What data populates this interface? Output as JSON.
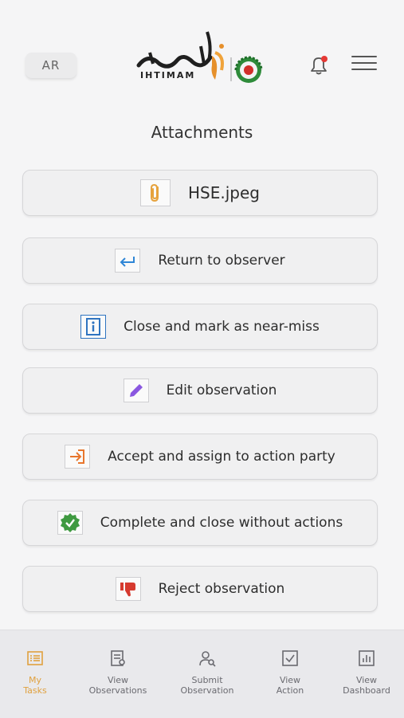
{
  "header": {
    "lang_label": "AR",
    "logo_text": "IHTIMAM",
    "notification_dot_color": "#e53935"
  },
  "page": {
    "title": "Attachments"
  },
  "attachment": {
    "file_name": "HSE.jpeg",
    "icon": "paperclip-icon",
    "icon_color": "#e6a23c"
  },
  "actions": [
    {
      "label": "Return to observer",
      "icon": "return-arrow-icon",
      "icon_color": "#2f86d6"
    },
    {
      "label": "Close and mark as near-miss",
      "icon": "info-icon",
      "icon_color": "#2f74c0"
    },
    {
      "label": "Edit observation",
      "icon": "pencil-icon",
      "icon_color": "#8a57e0"
    },
    {
      "label": "Accept and assign to action party",
      "icon": "enter-icon",
      "icon_color": "#e8762d"
    },
    {
      "label": "Complete and close without actions",
      "icon": "check-badge-icon",
      "icon_color": "#3f9a41"
    },
    {
      "label": "Reject observation",
      "icon": "thumbs-down-icon",
      "icon_color": "#d63a2f"
    }
  ],
  "tabs": [
    {
      "label": "My Tasks",
      "icon": "tasks-icon",
      "active": true
    },
    {
      "label": "View Observations",
      "icon": "observations-icon",
      "active": false
    },
    {
      "label": "Submit Observation",
      "icon": "submit-user-icon",
      "active": false
    },
    {
      "label": "View Action",
      "icon": "action-check-icon",
      "active": false
    },
    {
      "label": "View Dashboard",
      "icon": "dashboard-icon",
      "active": false
    }
  ],
  "colors": {
    "accent": "#e0a13f",
    "tab_inactive": "#6a6a70"
  }
}
